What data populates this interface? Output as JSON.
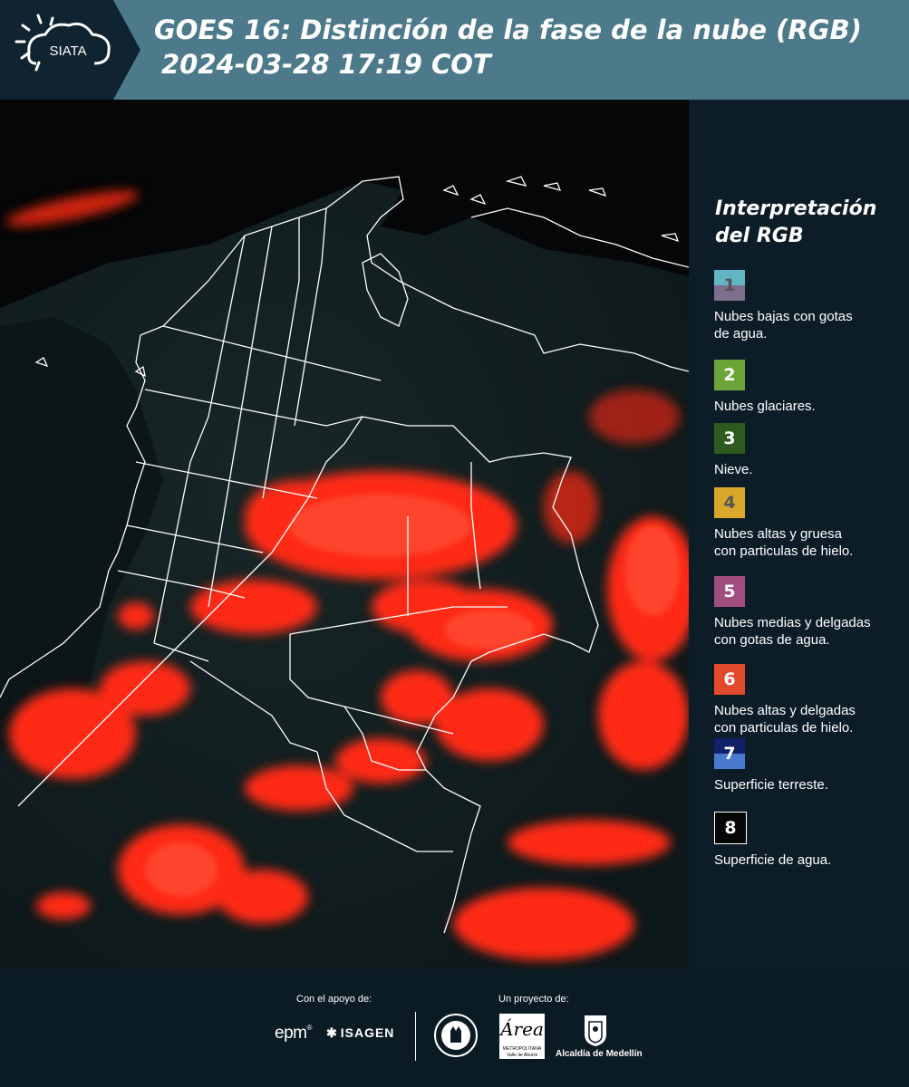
{
  "header": {
    "logo_text": "SIATA",
    "title_line1": "GOES 16: Distinción de la fase de la nube (RGB)",
    "title_line2": "2024-03-28 17:19 COT"
  },
  "legend": {
    "title_line1": "Interpretación",
    "title_line2": "del RGB",
    "items": [
      {
        "num": "1",
        "label_l1": "Nubes bajas con gotas",
        "label_l2": "de agua.",
        "color_top": "#62b6c4",
        "color_bottom": "#7c6e8c",
        "num_color": "#555555"
      },
      {
        "num": "2",
        "label_l1": "Nubes glaciares.",
        "label_l2": "",
        "color_top": "#6ba53a",
        "color_bottom": "#6ba53a",
        "num_color": "#ffffff"
      },
      {
        "num": "3",
        "label_l1": "Nieve.",
        "label_l2": "",
        "color_top": "#2d5a1f",
        "color_bottom": "#2d5a1f",
        "num_color": "#ffffff"
      },
      {
        "num": "4",
        "label_l1": "Nubes altas y gruesa",
        "label_l2": "con particulas de hielo.",
        "color_top": "#d9a82a",
        "color_bottom": "#d9a82a",
        "num_color": "#555555"
      },
      {
        "num": "5",
        "label_l1": "Nubes medias y delgadas",
        "label_l2": "con gotas de agua.",
        "color_top": "#a24d7f",
        "color_bottom": "#a24d7f",
        "num_color": "#ffffff"
      },
      {
        "num": "6",
        "label_l1": "Nubes altas y delgadas",
        "label_l2": "con particulas de hielo.",
        "color_top": "#e24a2c",
        "color_bottom": "#e24a2c",
        "num_color": "#ffffff"
      },
      {
        "num": "7",
        "label_l1": "Superficie terreste.",
        "label_l2": "",
        "color_top": "#12206a",
        "color_bottom": "#4a7ad0",
        "num_color": "#ffffff"
      },
      {
        "num": "8",
        "label_l1": "Superficie de agua.",
        "label_l2": "",
        "color_top": "#050805",
        "color_bottom": "#050805",
        "num_color": "#ffffff"
      }
    ]
  },
  "footer": {
    "support_label": "Con el apoyo de:",
    "project_label": "Un proyecto de:",
    "epm": "epm",
    "isagen": "ISAGEN",
    "area_line1": "METROPOLITANA",
    "area_line2": "Valle de Aburrá",
    "alcaldia": "Alcaldía de Medellín"
  }
}
